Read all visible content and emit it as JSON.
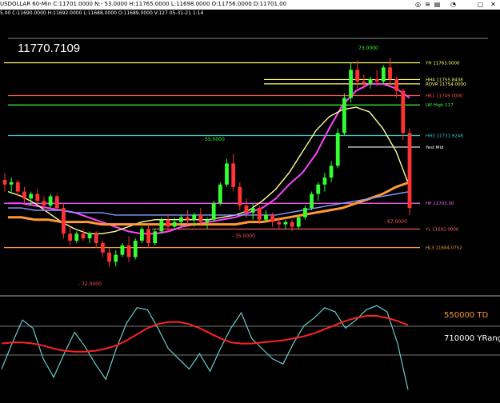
{
  "header": {
    "title": "USDOLLAR 60-Min  C:11701.0000  N:- 53.0000  H:11765.0000  L:11698.0000  O:11756.0000  D:11701.00",
    "ohlc_line": "5.00  C:11690.0000  H:11692.0000  L:11688.0000  O:11689.0000  V:127  05-31-21  1:14",
    "icons": [
      "globe-icon",
      "wifi-icon",
      "printer-icon",
      "bell-icon",
      "window-icon",
      "close-icon"
    ]
  },
  "price_display": "11770.7109",
  "colors": {
    "background": "#000000",
    "up_candle": "#33ff33",
    "down_candle": "#ff3333",
    "magenta_ma": "#ff44ff",
    "yellow_ma": "#ffff99",
    "orange_ma": "#ff9933",
    "blue_ma": "#8899ff",
    "yh_line": "#ffff66",
    "green_level": "#33ff33",
    "cyan_level": "#33cccc",
    "lw_line": "#ff66ff",
    "hl_line": "#ff9933",
    "stoch_fast": "#66cccc",
    "stoch_slow": "#ff2222"
  },
  "chart_data": [
    {
      "type": "candlestick",
      "title": "",
      "symbol": "USDOLLAR 60-Min",
      "level_labels": [
        {
          "text": "YH 11763.0000",
          "value": 11763.0
        },
        {
          "text": "HH4 11755.8438",
          "value": 11755.8438
        },
        {
          "text": "RDVR 11754.0000",
          "value": 11754.0
        },
        {
          "text": "HR1 11749.0000",
          "value": 11749.0
        },
        {
          "text": "LW High 117",
          "value": 11745.0
        },
        {
          "text": "HH3 11731.9248",
          "value": 11731.9248
        },
        {
          "text": "Yest Mid",
          "value": 11727.0
        },
        {
          "text": "HP 11703.00",
          "value": 11703.0
        },
        {
          "text": "YL 11692.0000",
          "value": 11692.0
        },
        {
          "text": "HL3 11684.0752",
          "value": 11684.0752
        }
      ],
      "swing_labels": [
        {
          "text": "73.0000",
          "value": 73
        },
        {
          "text": "55.0000",
          "value": 55
        },
        {
          "text": "- 35.0000",
          "value": -35
        },
        {
          "text": "- 72.0000",
          "value": -72
        },
        {
          "text": "- 67.0000",
          "value": -67
        }
      ],
      "candles": [
        {
          "o": 11713,
          "h": 11716,
          "l": 11708,
          "c": 11711
        },
        {
          "o": 11711,
          "h": 11714,
          "l": 11707,
          "c": 11712
        },
        {
          "o": 11712,
          "h": 11713,
          "l": 11706,
          "c": 11708
        },
        {
          "o": 11708,
          "h": 11710,
          "l": 11703,
          "c": 11705
        },
        {
          "o": 11705,
          "h": 11708,
          "l": 11702,
          "c": 11707
        },
        {
          "o": 11707,
          "h": 11709,
          "l": 11703,
          "c": 11704
        },
        {
          "o": 11704,
          "h": 11706,
          "l": 11700,
          "c": 11702
        },
        {
          "o": 11702,
          "h": 11707,
          "l": 11701,
          "c": 11706
        },
        {
          "o": 11706,
          "h": 11707,
          "l": 11700,
          "c": 11701
        },
        {
          "o": 11701,
          "h": 11703,
          "l": 11688,
          "c": 11690
        },
        {
          "o": 11690,
          "h": 11693,
          "l": 11685,
          "c": 11687
        },
        {
          "o": 11687,
          "h": 11691,
          "l": 11686,
          "c": 11690
        },
        {
          "o": 11690,
          "h": 11692,
          "l": 11687,
          "c": 11688
        },
        {
          "o": 11688,
          "h": 11691,
          "l": 11686,
          "c": 11690
        },
        {
          "o": 11690,
          "h": 11691,
          "l": 11684,
          "c": 11686
        },
        {
          "o": 11686,
          "h": 11687,
          "l": 11680,
          "c": 11682
        },
        {
          "o": 11682,
          "h": 11684,
          "l": 11676,
          "c": 11678
        },
        {
          "o": 11678,
          "h": 11683,
          "l": 11676,
          "c": 11681
        },
        {
          "o": 11681,
          "h": 11686,
          "l": 11680,
          "c": 11685
        },
        {
          "o": 11685,
          "h": 11689,
          "l": 11678,
          "c": 11680
        },
        {
          "o": 11680,
          "h": 11688,
          "l": 11679,
          "c": 11687
        },
        {
          "o": 11687,
          "h": 11693,
          "l": 11686,
          "c": 11692
        },
        {
          "o": 11692,
          "h": 11694,
          "l": 11684,
          "c": 11686
        },
        {
          "o": 11686,
          "h": 11692,
          "l": 11685,
          "c": 11691
        },
        {
          "o": 11691,
          "h": 11697,
          "l": 11690,
          "c": 11696
        },
        {
          "o": 11696,
          "h": 11698,
          "l": 11691,
          "c": 11693
        },
        {
          "o": 11693,
          "h": 11697,
          "l": 11692,
          "c": 11695
        },
        {
          "o": 11695,
          "h": 11698,
          "l": 11693,
          "c": 11697
        },
        {
          "o": 11697,
          "h": 11700,
          "l": 11694,
          "c": 11696
        },
        {
          "o": 11696,
          "h": 11699,
          "l": 11693,
          "c": 11698
        },
        {
          "o": 11698,
          "h": 11701,
          "l": 11694,
          "c": 11695
        },
        {
          "o": 11695,
          "h": 11697,
          "l": 11692,
          "c": 11696
        },
        {
          "o": 11696,
          "h": 11704,
          "l": 11695,
          "c": 11703
        },
        {
          "o": 11703,
          "h": 11712,
          "l": 11702,
          "c": 11711
        },
        {
          "o": 11711,
          "h": 11722,
          "l": 11710,
          "c": 11720
        },
        {
          "o": 11720,
          "h": 11724,
          "l": 11708,
          "c": 11710
        },
        {
          "o": 11710,
          "h": 11712,
          "l": 11700,
          "c": 11702
        },
        {
          "o": 11702,
          "h": 11705,
          "l": 11697,
          "c": 11699
        },
        {
          "o": 11699,
          "h": 11703,
          "l": 11696,
          "c": 11701
        },
        {
          "o": 11701,
          "h": 11702,
          "l": 11694,
          "c": 11696
        },
        {
          "o": 11696,
          "h": 11700,
          "l": 11695,
          "c": 11698
        },
        {
          "o": 11698,
          "h": 11699,
          "l": 11693,
          "c": 11695
        },
        {
          "o": 11695,
          "h": 11697,
          "l": 11692,
          "c": 11694
        },
        {
          "o": 11694,
          "h": 11696,
          "l": 11692,
          "c": 11695
        },
        {
          "o": 11695,
          "h": 11696,
          "l": 11691,
          "c": 11693
        },
        {
          "o": 11693,
          "h": 11698,
          "l": 11692,
          "c": 11697
        },
        {
          "o": 11697,
          "h": 11702,
          "l": 11696,
          "c": 11701
        },
        {
          "o": 11701,
          "h": 11708,
          "l": 11700,
          "c": 11707
        },
        {
          "o": 11707,
          "h": 11712,
          "l": 11704,
          "c": 11711
        },
        {
          "o": 11711,
          "h": 11716,
          "l": 11708,
          "c": 11714
        },
        {
          "o": 11714,
          "h": 11721,
          "l": 11712,
          "c": 11719
        },
        {
          "o": 11719,
          "h": 11735,
          "l": 11718,
          "c": 11733
        },
        {
          "o": 11733,
          "h": 11750,
          "l": 11732,
          "c": 11748
        },
        {
          "o": 11748,
          "h": 11763,
          "l": 11746,
          "c": 11760
        },
        {
          "o": 11760,
          "h": 11764,
          "l": 11752,
          "c": 11755
        },
        {
          "o": 11755,
          "h": 11758,
          "l": 11752,
          "c": 11754
        },
        {
          "o": 11754,
          "h": 11757,
          "l": 11752,
          "c": 11756
        },
        {
          "o": 11756,
          "h": 11760,
          "l": 11753,
          "c": 11755
        },
        {
          "o": 11755,
          "h": 11762,
          "l": 11754,
          "c": 11761
        },
        {
          "o": 11761,
          "h": 11765,
          "l": 11753,
          "c": 11756
        },
        {
          "o": 11756,
          "h": 11757,
          "l": 11748,
          "c": 11751
        },
        {
          "o": 11751,
          "h": 11752,
          "l": 11730,
          "c": 11733
        },
        {
          "o": 11733,
          "h": 11735,
          "l": 11698,
          "c": 11701
        }
      ],
      "moving_averages": [
        {
          "name": "magenta",
          "values": [
            11703,
            11703,
            11702,
            11701,
            11700,
            11699,
            11697,
            11695,
            11693,
            11691,
            11690,
            11690,
            11691,
            11693,
            11694,
            11695,
            11696,
            11697,
            11699,
            11701,
            11705,
            11711,
            11716,
            11724,
            11735,
            11745,
            11751,
            11754,
            11754,
            11752,
            11748
          ]
        },
        {
          "name": "yellow",
          "values": [
            11708,
            11706,
            11703,
            11699,
            11695,
            11692,
            11690,
            11690,
            11691,
            11693,
            11695,
            11696,
            11696,
            11696,
            11696,
            11696,
            11697,
            11698,
            11700,
            11704,
            11709,
            11716,
            11725,
            11734,
            11740,
            11743,
            11744,
            11742,
            11735,
            11725,
            11710
          ]
        },
        {
          "name": "orange",
          "values": [
            11697,
            11697,
            11696,
            11696,
            11695,
            11695,
            11695,
            11694,
            11694,
            11694,
            11694,
            11694,
            11694,
            11694,
            11694,
            11694,
            11694,
            11694,
            11695,
            11695,
            11696,
            11697,
            11698,
            11699,
            11700,
            11701,
            11703,
            11705,
            11707,
            11710,
            11712
          ]
        },
        {
          "name": "blue",
          "values": [
            11701,
            11701,
            11700,
            11700,
            11700,
            11699,
            11699,
            11699,
            11698,
            11698,
            11698,
            11698,
            11698,
            11698,
            11698,
            11698,
            11698,
            11698,
            11698,
            11698,
            11698,
            11699,
            11700,
            11701,
            11702,
            11703,
            11704,
            11705,
            11706,
            11707,
            11708
          ]
        }
      ]
    },
    {
      "type": "line",
      "title": "",
      "indicator_labels": [
        "550000 TD",
        "710000 YRange"
      ],
      "series": [
        {
          "name": "",
          "values": [
            30,
            55,
            78,
            70,
            40,
            22,
            45,
            66,
            52,
            35,
            20,
            50,
            75,
            90,
            88,
            70,
            50,
            40,
            30,
            45,
            28,
            50,
            70,
            85,
            60,
            50,
            40,
            35,
            55,
            72,
            80,
            90,
            86,
            70,
            78,
            88,
            92,
            86,
            55,
            10
          ]
        },
        {
          "name": "",
          "values": [
            55,
            56,
            56,
            55,
            53,
            50,
            48,
            47,
            47,
            48,
            50,
            53,
            58,
            64,
            70,
            74,
            76,
            76,
            74,
            70,
            65,
            60,
            56,
            55,
            55,
            56,
            57,
            58,
            60,
            62,
            65,
            69,
            73,
            77,
            80,
            82,
            82,
            80,
            77,
            73
          ]
        }
      ]
    }
  ]
}
